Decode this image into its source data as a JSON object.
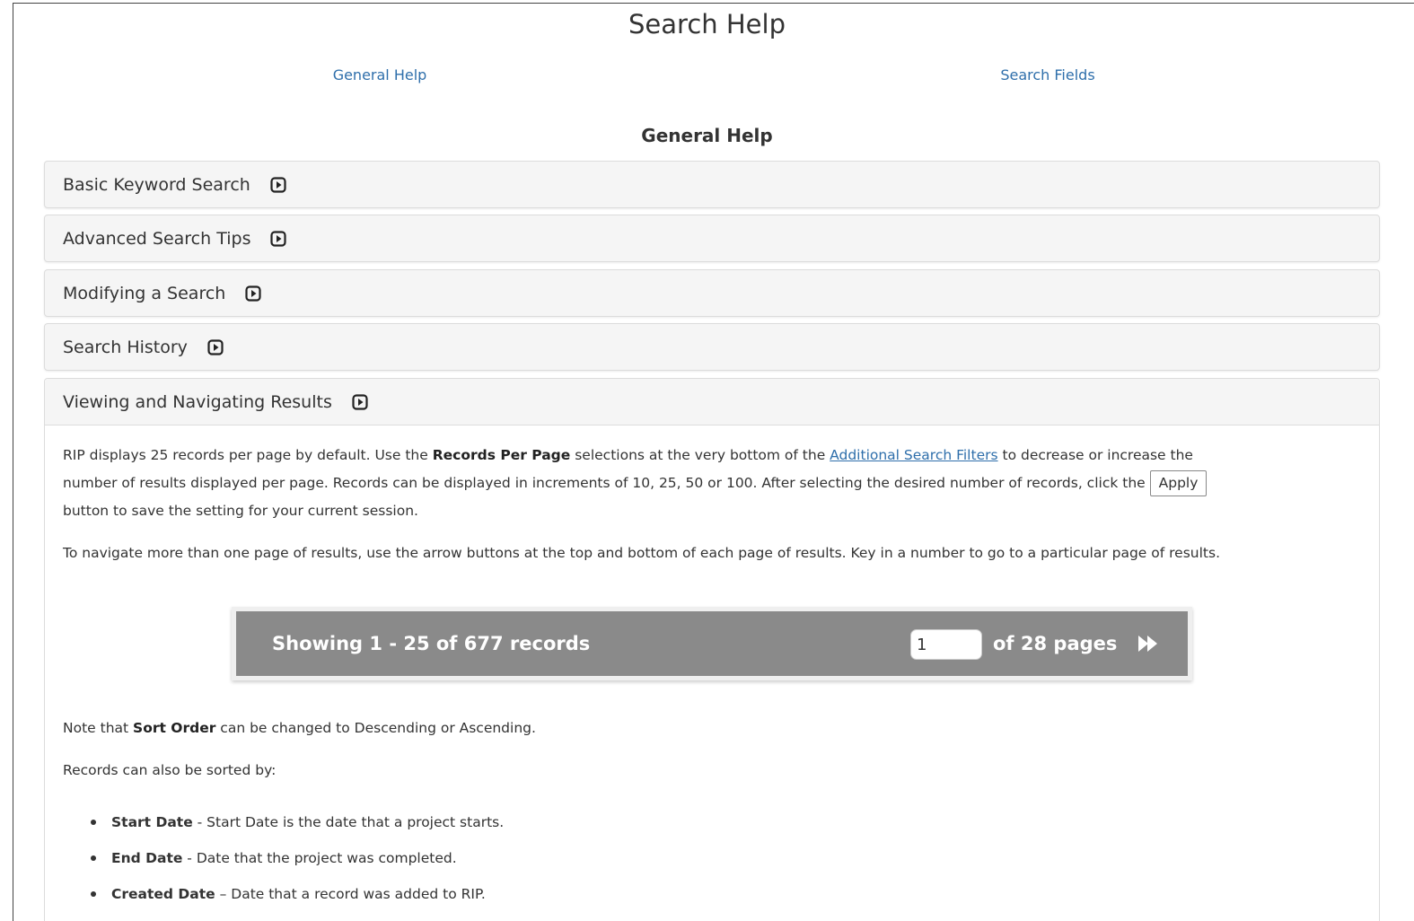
{
  "page_title": "Search Help",
  "nav": {
    "general_help": "General Help",
    "search_fields": "Search Fields"
  },
  "section_title": "General Help",
  "accordion": [
    {
      "label": "Basic Keyword Search"
    },
    {
      "label": "Advanced Search Tips"
    },
    {
      "label": "Modifying a Search"
    },
    {
      "label": "Search History"
    },
    {
      "label": "Viewing and Navigating Results"
    }
  ],
  "content": {
    "p1_a": "RIP displays 25 records per page by default. Use the ",
    "p1_b": "Records Per Page",
    "p1_c": " selections at the very bottom of the ",
    "p1_link": "Additional Search Filters",
    "p1_d": " to decrease or increase the",
    "p1_line2": "number of results displayed per page. Records can be displayed in increments of 10, 25, 50 or 100. After selecting the desired number of records, click the",
    "apply_label": "Apply",
    "p1_line3": "button to save the setting for your current session.",
    "p2": "To navigate more than one page of results, use the arrow buttons at the top and bottom of each page of results. Key in a number to go to a particular page of results.",
    "note_a": "Note that ",
    "note_b": "Sort Order",
    "note_c": " can be changed to Descending or Ascending.",
    "sorted_by": "Records can also be sorted by:",
    "sorts": [
      {
        "term": "Start Date",
        "desc": " - Start Date is the date that a project starts."
      },
      {
        "term": "End Date",
        "desc": " - Date that the project was completed."
      },
      {
        "term": "Created Date",
        "desc": " – Date that a record was added to RIP."
      }
    ]
  },
  "pager": {
    "showing": "Showing 1 - 25 of 677 records",
    "page_value": "1",
    "of_pages": "of 28 pages"
  },
  "icons": {
    "toggle": "expand-toggle-icon",
    "next": "fast-forward-icon"
  },
  "colors": {
    "link": "#2f6fab",
    "pager_bg": "#8a8a8a",
    "panel_bg": "#f5f5f5"
  }
}
